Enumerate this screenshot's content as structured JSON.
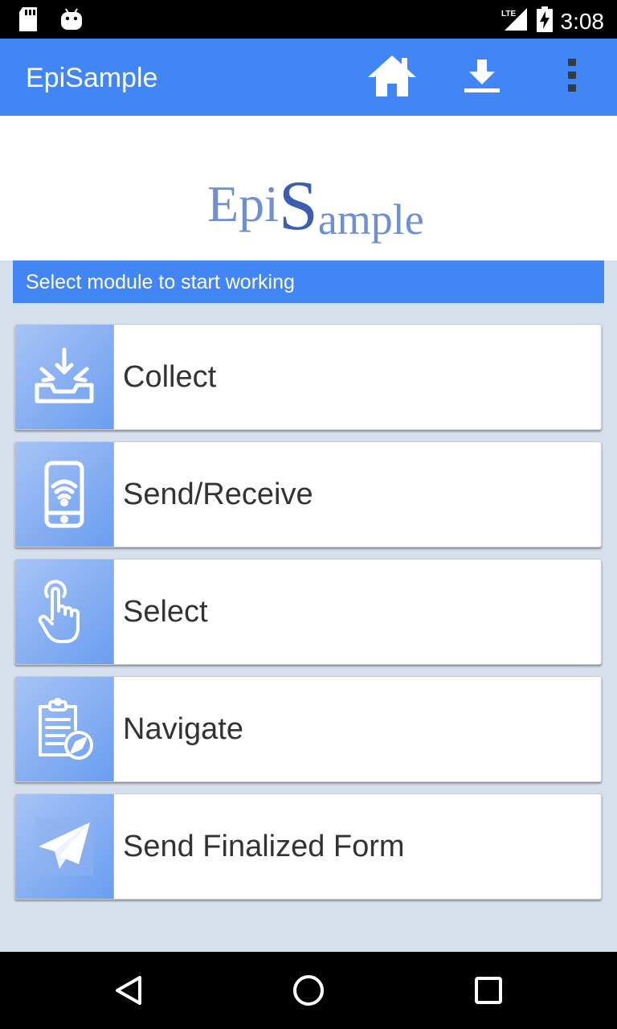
{
  "status_bar": {
    "time": "3:08",
    "network": "LTE",
    "icons": [
      "sd-card-icon",
      "android-icon",
      "lte-signal-icon",
      "battery-charging-icon"
    ]
  },
  "app_bar": {
    "title": "EpiSample",
    "actions": [
      "home-icon",
      "download-icon",
      "overflow-menu-icon"
    ]
  },
  "logo": {
    "part1": "Epi",
    "part2": "S",
    "part3": "ample"
  },
  "banner": {
    "text": "Select module to start working"
  },
  "modules": [
    {
      "label": "Collect",
      "icon": "collect-icon"
    },
    {
      "label": "Send/Receive",
      "icon": "phone-wifi-icon"
    },
    {
      "label": "Select",
      "icon": "touch-hand-icon"
    },
    {
      "label": "Navigate",
      "icon": "clipboard-compass-icon"
    },
    {
      "label": "Send Finalized Form",
      "icon": "paper-plane-icon"
    }
  ],
  "nav_bar": {
    "buttons": [
      "back-icon",
      "home-circle-icon",
      "recents-icon"
    ]
  },
  "colors": {
    "primary": "#4285f4",
    "background": "#d6dfec",
    "icon_tile": "#7aa8f2"
  }
}
